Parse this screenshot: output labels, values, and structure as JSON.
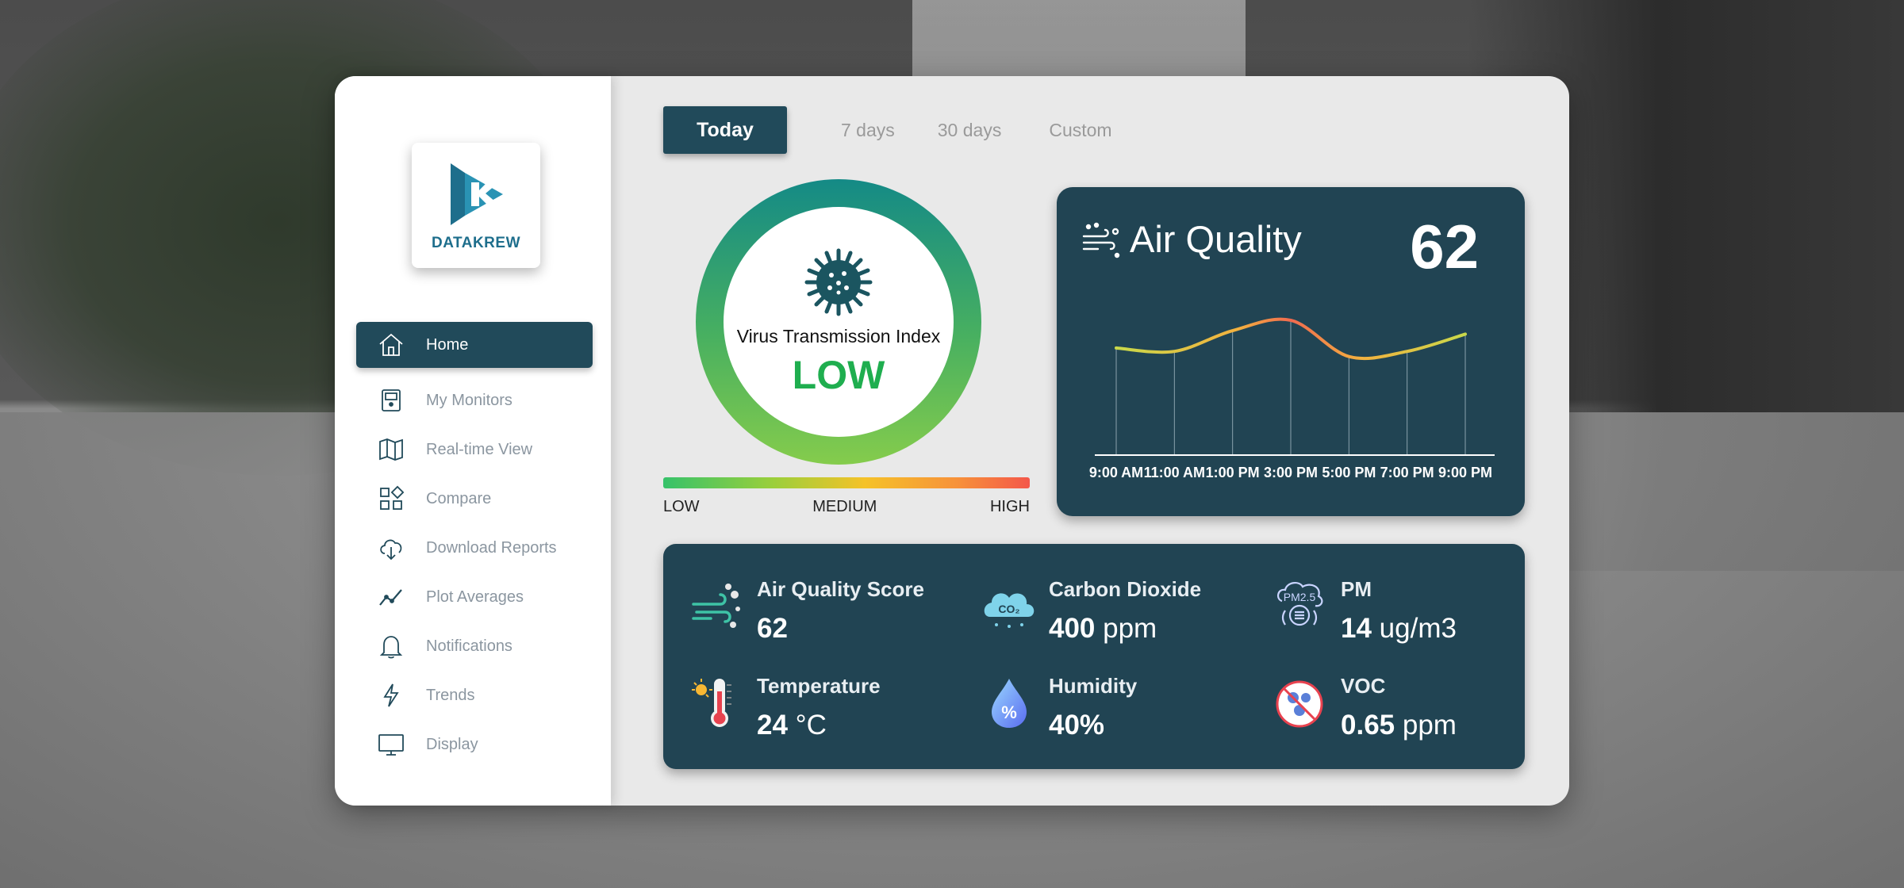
{
  "brand": {
    "name": "DATAKREW",
    "accent": "#1e6e8c"
  },
  "sidebar": {
    "items": [
      {
        "label": "Home",
        "icon": "home-icon",
        "active": true
      },
      {
        "label": "My Monitors",
        "icon": "monitor-device-icon"
      },
      {
        "label": "Real-time View",
        "icon": "map-icon"
      },
      {
        "label": "Compare",
        "icon": "compare-grid-icon"
      },
      {
        "label": "Download Reports",
        "icon": "cloud-download-icon"
      },
      {
        "label": "Plot Averages",
        "icon": "line-chart-icon"
      },
      {
        "label": "Notifications",
        "icon": "bell-icon"
      },
      {
        "label": "Trends",
        "icon": "bolt-icon"
      },
      {
        "label": "Display",
        "icon": "display-icon"
      }
    ]
  },
  "tabs": [
    "Today",
    "7 days",
    "30 days",
    "Custom"
  ],
  "virus_index": {
    "title": "Virus Transmission Index",
    "value": "LOW",
    "scale_labels": [
      "LOW",
      "MEDIUM",
      "HIGH"
    ]
  },
  "air_quality": {
    "title": "Air Quality",
    "value": "62"
  },
  "chart_data": {
    "type": "line",
    "x": [
      "9:00 AM",
      "11:00 AM",
      "1:00 PM",
      "3:00 PM",
      "5:00 PM",
      "7:00 PM",
      "9:00 PM"
    ],
    "series": [
      {
        "values": [
          62,
          60,
          72,
          78,
          57,
          60,
          70
        ]
      }
    ],
    "ylim": [
      0,
      100
    ],
    "grid": "vertical",
    "colors": [
      "#c9d94a",
      "#f3b13f",
      "#f06a4f"
    ]
  },
  "metrics": [
    {
      "label": "Air Quality Score",
      "value": "62",
      "unit": "",
      "icon": "wind-icon"
    },
    {
      "label": "Carbon Dioxide",
      "value": "400",
      "unit": " ppm",
      "icon": "co2-cloud-icon"
    },
    {
      "label": "PM",
      "value": "14",
      "unit": " ug/m3",
      "icon": "pm25-icon"
    },
    {
      "label": "Temperature",
      "value": "24",
      "unit": " °C",
      "icon": "thermometer-icon"
    },
    {
      "label": "Humidity",
      "value": "40%",
      "unit": "",
      "icon": "humidity-drop-icon"
    },
    {
      "label": "VOC",
      "value": "0.65",
      "unit": " ppm",
      "icon": "voc-icon"
    }
  ]
}
